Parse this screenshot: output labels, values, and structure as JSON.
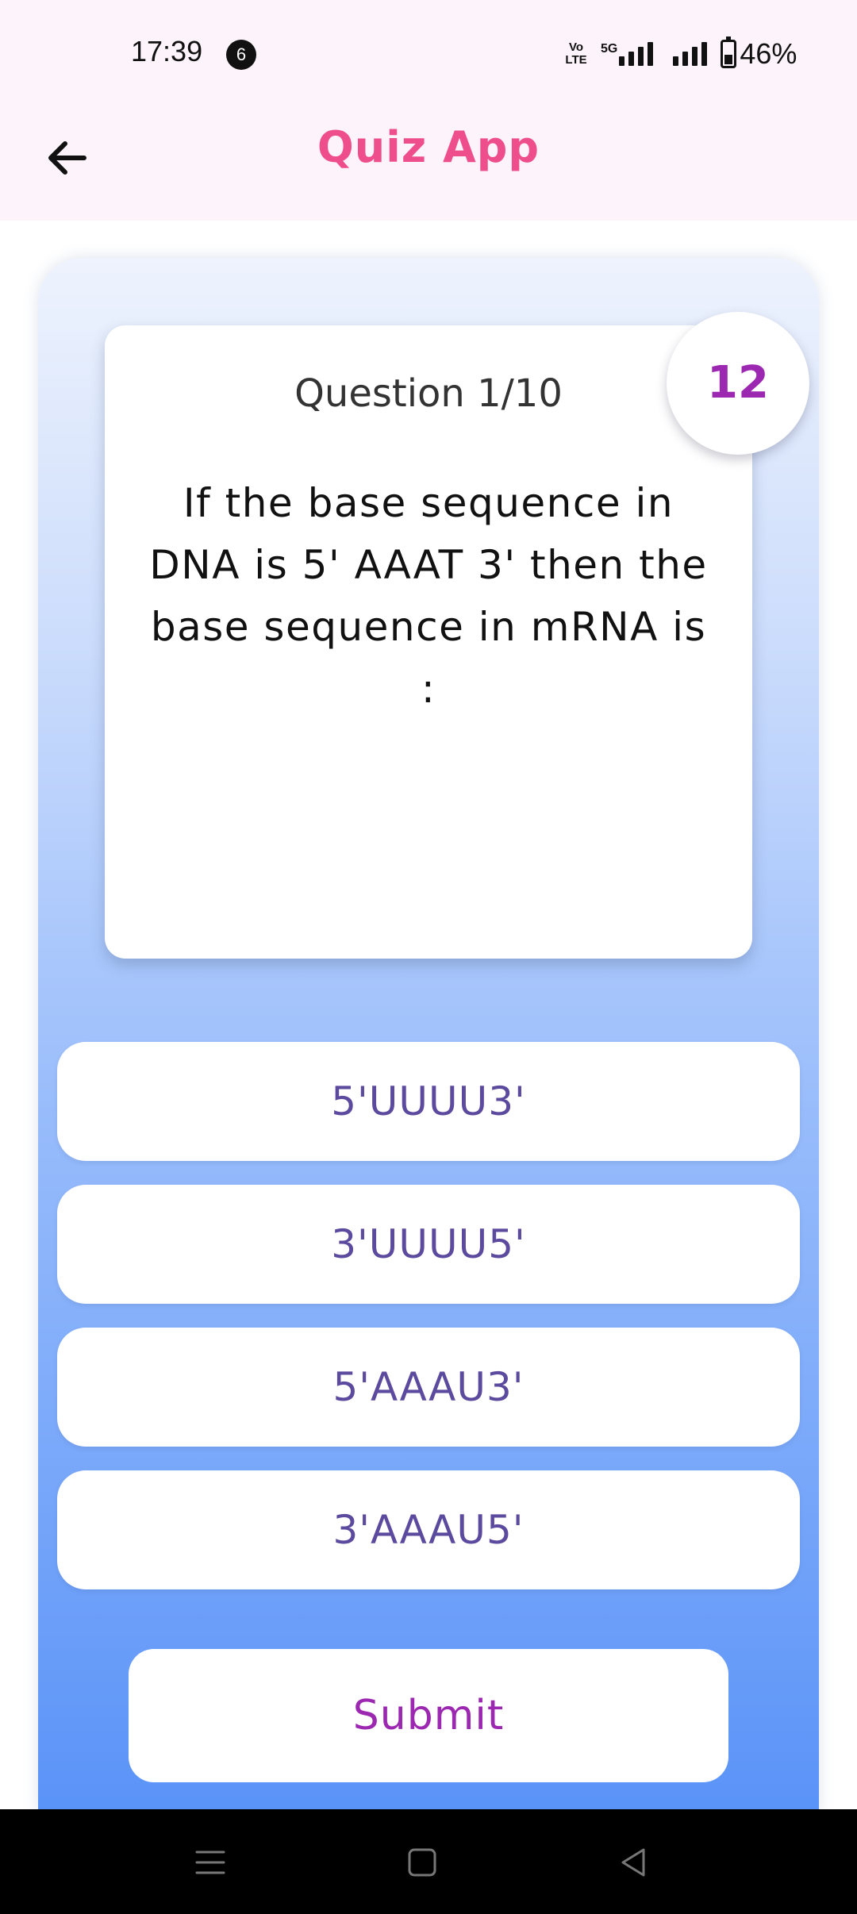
{
  "status_bar": {
    "time": "17:39",
    "notification_count": "6",
    "network": "5G",
    "volte": "Vo LTE",
    "battery_percent": "46%"
  },
  "app_bar": {
    "title": "Quiz App",
    "back_icon": "arrow-left-icon"
  },
  "quiz": {
    "counter": "Question 1/10",
    "timer": "12",
    "question": "If the base sequence in DNA is 5' AAAT 3' then the base sequence in mRNA is :",
    "options": [
      {
        "label": "5'UUUU3'"
      },
      {
        "label": "3'UUUU5'"
      },
      {
        "label": "5'AAAU3'"
      },
      {
        "label": "3'AAAU5'"
      }
    ],
    "submit_label": "Submit"
  },
  "nav_bar": {
    "icons": [
      "menu-icon",
      "home-square-icon",
      "back-triangle-icon"
    ]
  },
  "colors": {
    "title": "#ee4f8c",
    "accent": "#9c27b0",
    "option_text": "#5b4a9e",
    "gradient_top": "#eef3fd",
    "gradient_bottom": "#5a93f8"
  }
}
